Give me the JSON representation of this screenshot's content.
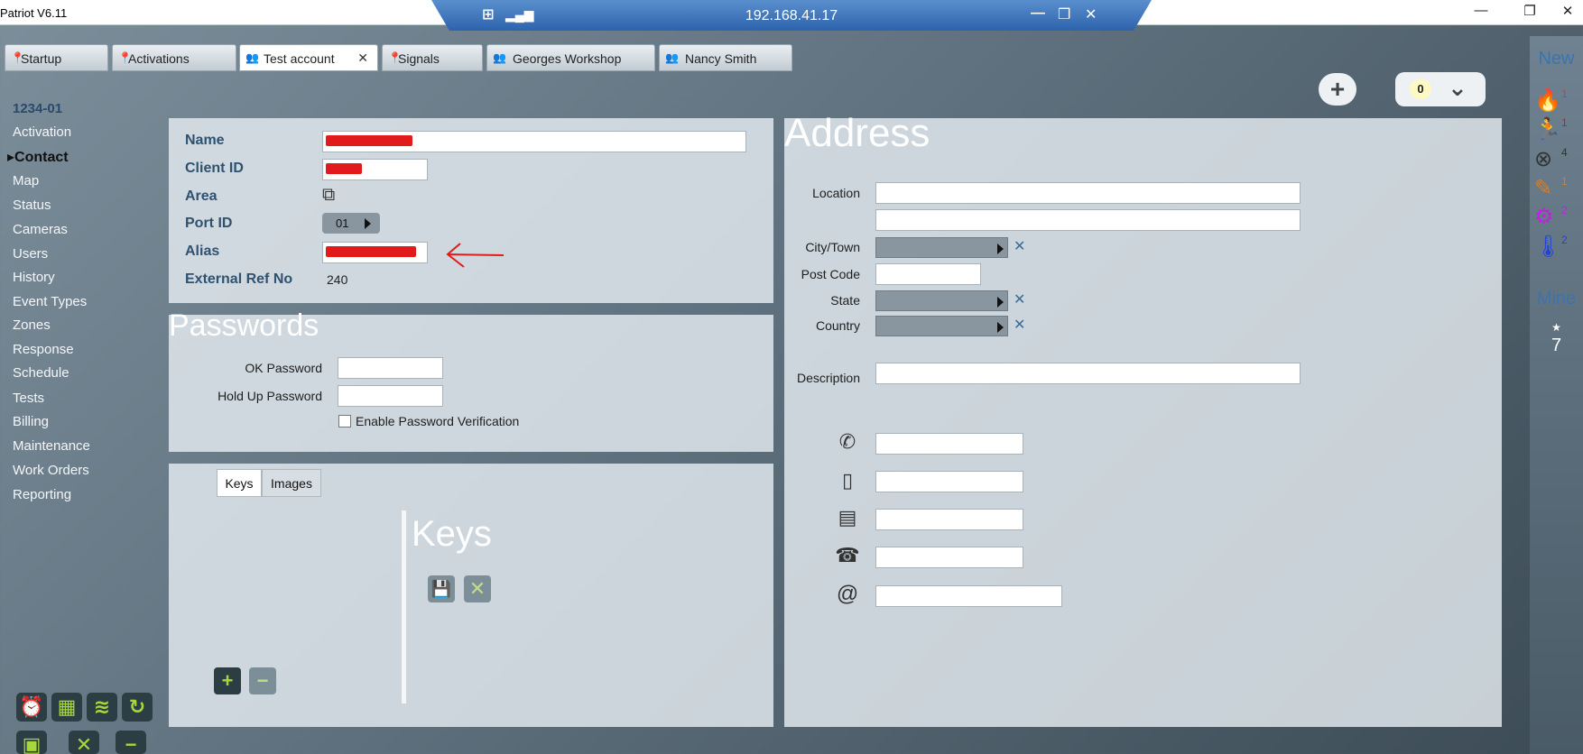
{
  "window": {
    "app_title": "Patriot V6.11",
    "remote_ip": "192.168.41.17",
    "remote_min": "—",
    "remote_restore": "❐",
    "remote_close": "✕",
    "win_min": "—",
    "win_restore": "❐",
    "win_close": "✕"
  },
  "tabs": [
    {
      "label": "Startup",
      "icon": "pin-icon"
    },
    {
      "label": "Activations",
      "icon": "pin-icon"
    },
    {
      "label": "Test account",
      "icon": "people-icon",
      "close": "✕"
    },
    {
      "label": "Signals",
      "icon": "pin-icon"
    },
    {
      "label": "Georges Workshop",
      "icon": "people-icon"
    },
    {
      "label": "Nancy Smith",
      "icon": "people-icon"
    }
  ],
  "sidebar": {
    "account_id": "1234-01",
    "items": [
      "Activation",
      "Contact",
      "Map",
      "Status",
      "Cameras",
      "Users",
      "History",
      "Event Types",
      "Zones",
      "Response",
      "Schedule",
      "Tests",
      "Billing",
      "Maintenance",
      "Work Orders",
      "Reporting"
    ],
    "active": "Contact"
  },
  "toolbar": {
    "add_icon": "plus-icon",
    "counter_value": "0",
    "chevron": "chevron-down-icon"
  },
  "contact": {
    "name_label": "Name",
    "client_id_label": "Client ID",
    "area_label": "Area",
    "port_id_label": "Port ID",
    "port_id_value": "01",
    "alias_label": "Alias",
    "external_ref_label": "External Ref No",
    "external_ref_value": "240"
  },
  "passwords": {
    "heading": "Passwords",
    "ok_label": "OK Password",
    "hold_up_label": "Hold Up Password",
    "verify_label": "Enable Password Verification"
  },
  "keys_panel": {
    "tab_keys": "Keys",
    "tab_images": "Images",
    "heading": "Keys"
  },
  "address": {
    "heading": "Address",
    "location_label": "Location",
    "city_label": "City/Town",
    "post_code_label": "Post Code",
    "state_label": "State",
    "country_label": "Country",
    "description_label": "Description"
  },
  "right_strip": {
    "new_label": "New",
    "mine_label": "Mine",
    "mine_count": "7",
    "alarms": [
      {
        "icon": "fire-icon",
        "count": "1",
        "color": "#e03a1c"
      },
      {
        "icon": "intruder-icon",
        "count": "1",
        "color": "#e01010"
      },
      {
        "icon": "fault-icon",
        "count": "4",
        "color": "#333333"
      },
      {
        "icon": "tamper-icon",
        "count": "1",
        "color": "#e07a1c"
      },
      {
        "icon": "service-icon",
        "count": "2",
        "color": "#c020e0"
      },
      {
        "icon": "temperature-icon",
        "count": "2",
        "color": "#2040e0"
      }
    ]
  },
  "colors": {
    "accent": "#3c73ad",
    "redaction": "#e11b1b",
    "button_green": "#a6d83c"
  }
}
